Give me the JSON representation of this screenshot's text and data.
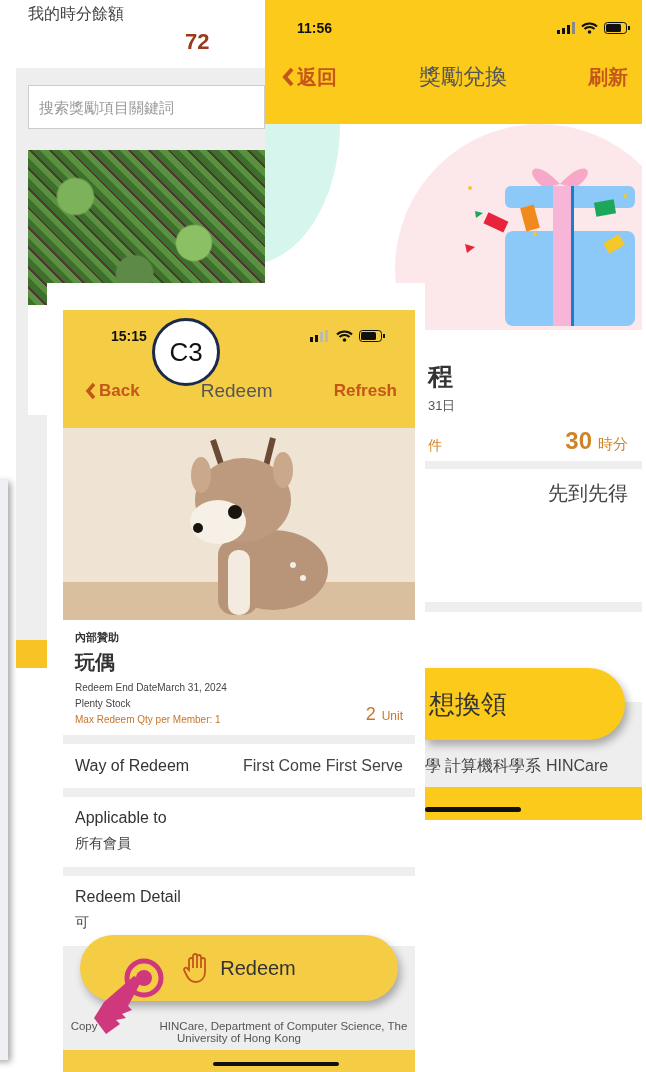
{
  "balance_screen": {
    "label": "我的時分餘額",
    "balance": "72",
    "search": {
      "placeholder": "搜索獎勵項目關鍵詞"
    }
  },
  "reward_screen": {
    "status_bar": {
      "time": "11:56"
    },
    "nav": {
      "back": "返回",
      "title": "獎勵兌換",
      "action": "刷新"
    },
    "title": "程",
    "date": "31日",
    "stock_label": "件",
    "cost": "30",
    "cost_unit": "時分",
    "redeem_way": "先到先得",
    "redeem_button": "想換領",
    "footer": "學 計算機科學系 HINCare"
  },
  "redeem_screen": {
    "status_bar": {
      "time": "15:15"
    },
    "nav": {
      "back": "Back",
      "title": "Redeem",
      "action": "Refresh"
    },
    "sponsor": "內部贊助",
    "name": "玩偶",
    "end_date": "Redeem End DateMarch 31, 2024",
    "stock": "Plenty Stock",
    "max_qty": "Max Redeem Qty per Member: 1",
    "cost": "2",
    "cost_unit": "Unit",
    "sections": [
      {
        "kind": "inline",
        "label": "Way of Redeem",
        "value": "First Come First Serve"
      },
      {
        "kind": "stacked",
        "label": "Applicable to",
        "value": "所有會員"
      },
      {
        "kind": "stacked",
        "label": "Redeem Detail",
        "value": "可"
      }
    ],
    "redeem_button": "Redeem",
    "footer": [
      "Copy",
      "HINCare, Department of Computer Science, The",
      "University of Hong Kong"
    ]
  },
  "callout": {
    "label": "C3"
  }
}
